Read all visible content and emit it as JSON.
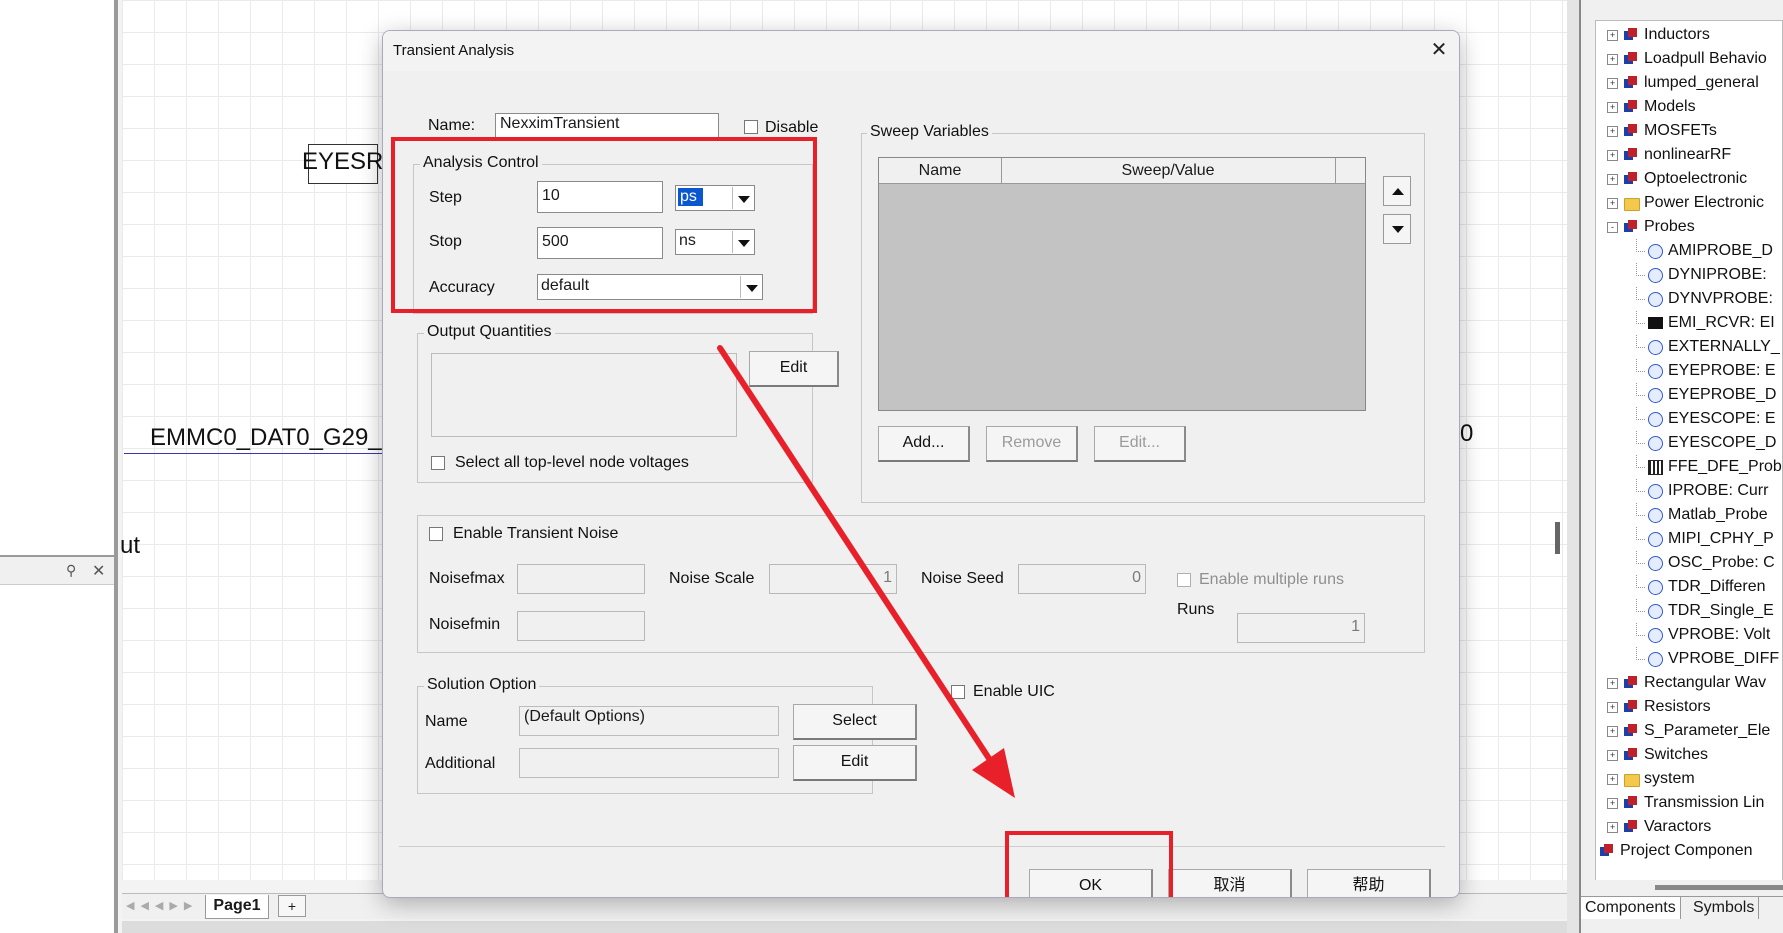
{
  "canvas": {
    "text_eyes": "EYESR",
    "text_emmc": "EMMC0_DAT0_G29_",
    "text_ut": "ut",
    "text_zero": "0",
    "page_tab": "Page1",
    "page_add": "+"
  },
  "tree": {
    "items": [
      {
        "label": "Inductors",
        "icon": "component",
        "level": 1,
        "exp": "+"
      },
      {
        "label": "Loadpull Behavio",
        "icon": "component",
        "level": 1,
        "exp": "+"
      },
      {
        "label": "lumped_general",
        "icon": "component",
        "level": 1,
        "exp": "+"
      },
      {
        "label": "Models",
        "icon": "component",
        "level": 1,
        "exp": "+"
      },
      {
        "label": "MOSFETs",
        "icon": "component",
        "level": 1,
        "exp": "+"
      },
      {
        "label": "nonlinearRF",
        "icon": "component",
        "level": 1,
        "exp": "+"
      },
      {
        "label": "Optoelectronic",
        "icon": "component",
        "level": 1,
        "exp": "+"
      },
      {
        "label": "Power Electronic",
        "icon": "folder",
        "level": 1,
        "exp": "+"
      },
      {
        "label": "Probes",
        "icon": "component",
        "level": 1,
        "exp": "-"
      },
      {
        "label": "AMIPROBE_D",
        "icon": "probe",
        "level": 2
      },
      {
        "label": "DYNIPROBE:",
        "icon": "probe",
        "level": 2
      },
      {
        "label": "DYNVPROBE:",
        "icon": "probe",
        "level": 2
      },
      {
        "label": "EMI_RCVR: EI",
        "icon": "emi",
        "level": 2
      },
      {
        "label": "EXTERNALLY_",
        "icon": "probe",
        "level": 2
      },
      {
        "label": "EYEPROBE: E",
        "icon": "probe",
        "level": 2
      },
      {
        "label": "EYEPROBE_D",
        "icon": "probe",
        "level": 2
      },
      {
        "label": "EYESCOPE: E",
        "icon": "probe",
        "level": 2
      },
      {
        "label": "EYESCOPE_D",
        "icon": "probe",
        "level": 2
      },
      {
        "label": "FFE_DFE_Prob",
        "icon": "ffe",
        "level": 2
      },
      {
        "label": "IPROBE: Curr",
        "icon": "probe",
        "level": 2
      },
      {
        "label": "Matlab_Probe",
        "icon": "probe",
        "level": 2
      },
      {
        "label": "MIPI_CPHY_P",
        "icon": "probe",
        "level": 2
      },
      {
        "label": "OSC_Probe: C",
        "icon": "probe",
        "level": 2
      },
      {
        "label": "TDR_Differen",
        "icon": "probe",
        "level": 2
      },
      {
        "label": "TDR_Single_E",
        "icon": "probe",
        "level": 2
      },
      {
        "label": "VPROBE: Volt",
        "icon": "probe",
        "level": 2
      },
      {
        "label": "VPROBE_DIFF",
        "icon": "probe",
        "level": 2
      },
      {
        "label": "Rectangular Wav",
        "icon": "component",
        "level": 1,
        "exp": "+"
      },
      {
        "label": "Resistors",
        "icon": "component",
        "level": 1,
        "exp": "+"
      },
      {
        "label": "S_Parameter_Ele",
        "icon": "component",
        "level": 1,
        "exp": "+"
      },
      {
        "label": "Switches",
        "icon": "component",
        "level": 1,
        "exp": "+"
      },
      {
        "label": "system",
        "icon": "folder",
        "level": 1,
        "exp": "+"
      },
      {
        "label": "Transmission Lin",
        "icon": "component",
        "level": 1,
        "exp": "+"
      },
      {
        "label": "Varactors",
        "icon": "component",
        "level": 1,
        "exp": "+"
      },
      {
        "label": "Project Componen",
        "icon": "component",
        "level": 0,
        "exp": "+"
      }
    ],
    "tab_components": "Components",
    "tab_symbols": "Symbols"
  },
  "dialog": {
    "title": "Transient Analysis",
    "name_label": "Name:",
    "name_value": "NexximTransient",
    "disable_label": "Disable",
    "analysis_control": {
      "title": "Analysis Control",
      "step_label": "Step",
      "step_value": "10",
      "step_unit": "ps",
      "stop_label": "Stop",
      "stop_value": "500",
      "stop_unit": "ns",
      "accuracy_label": "Accuracy",
      "accuracy_value": "default"
    },
    "output_quantities": {
      "title": "Output Quantities",
      "edit": "Edit",
      "select_all": "Select all top-level node voltages"
    },
    "sweep": {
      "title": "Sweep Variables",
      "col_name": "Name",
      "col_sweep": "Sweep/Value",
      "add": "Add...",
      "remove": "Remove",
      "edit": "Edit..."
    },
    "noise": {
      "enable": "Enable Transient Noise",
      "fmax": "Noisefmax",
      "fmin": "Noisefmin",
      "scale_label": "Noise Scale",
      "scale_value": "1",
      "seed_label": "Noise Seed",
      "seed_value": "0",
      "multiple_runs": "Enable multiple runs",
      "runs_label": "Runs",
      "runs_value": "1"
    },
    "solution": {
      "title": "Solution Option",
      "name_label": "Name",
      "name_value": "(Default Options)",
      "select": "Select",
      "additional_label": "Additional",
      "edit": "Edit"
    },
    "enable_uic": "Enable UIC",
    "ok": "OK",
    "cancel": "取消",
    "help": "帮助"
  },
  "colors": {
    "annotation_red": "#e8202a",
    "selection_blue": "#0a57d0"
  }
}
